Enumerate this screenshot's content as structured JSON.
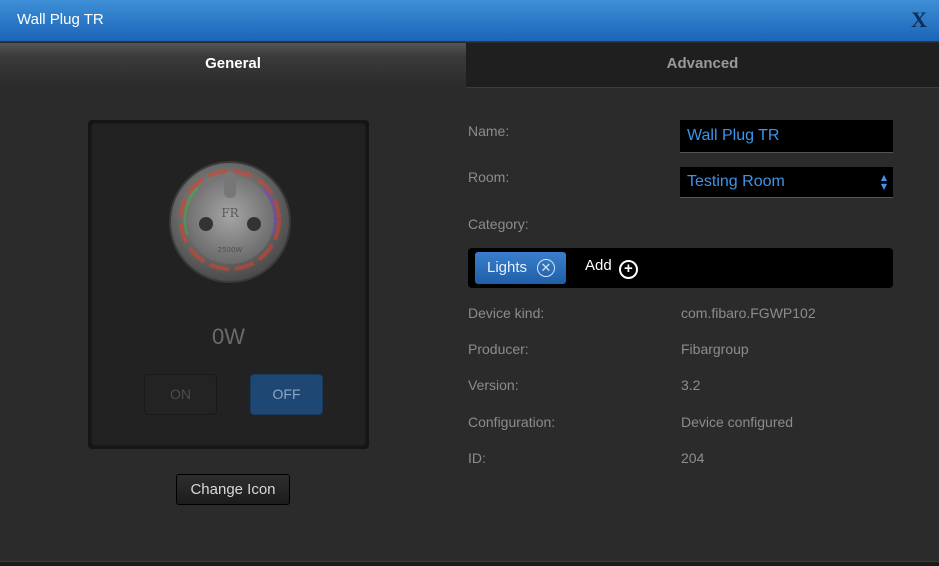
{
  "window": {
    "title": "Wall Plug TR",
    "close_label": "X"
  },
  "tabs": [
    {
      "label": "General",
      "active": true
    },
    {
      "label": "Advanced",
      "active": false
    }
  ],
  "device": {
    "icon": "wall-plug-icon",
    "power_reading": "0W",
    "on_label": "ON",
    "off_label": "OFF",
    "change_icon_label": "Change Icon"
  },
  "form": {
    "name_label": "Name:",
    "name_value": "Wall Plug TR",
    "room_label": "Room:",
    "room_value": "Testing Room",
    "category_label": "Category:",
    "category_chip": "Lights",
    "add_label": "Add",
    "device_kind_label": "Device kind:",
    "device_kind_value": "com.fibaro.FGWP102",
    "producer_label": "Producer:",
    "producer_value": "Fibargroup",
    "version_label": "Version:",
    "version_value": "3.2",
    "configuration_label": "Configuration:",
    "configuration_value": "Device configured",
    "id_label": "ID:",
    "id_value": "204"
  },
  "colors": {
    "titlebar": "#1c64b8",
    "accent_blue": "#3b95ea",
    "background": "#2b2b2b"
  }
}
